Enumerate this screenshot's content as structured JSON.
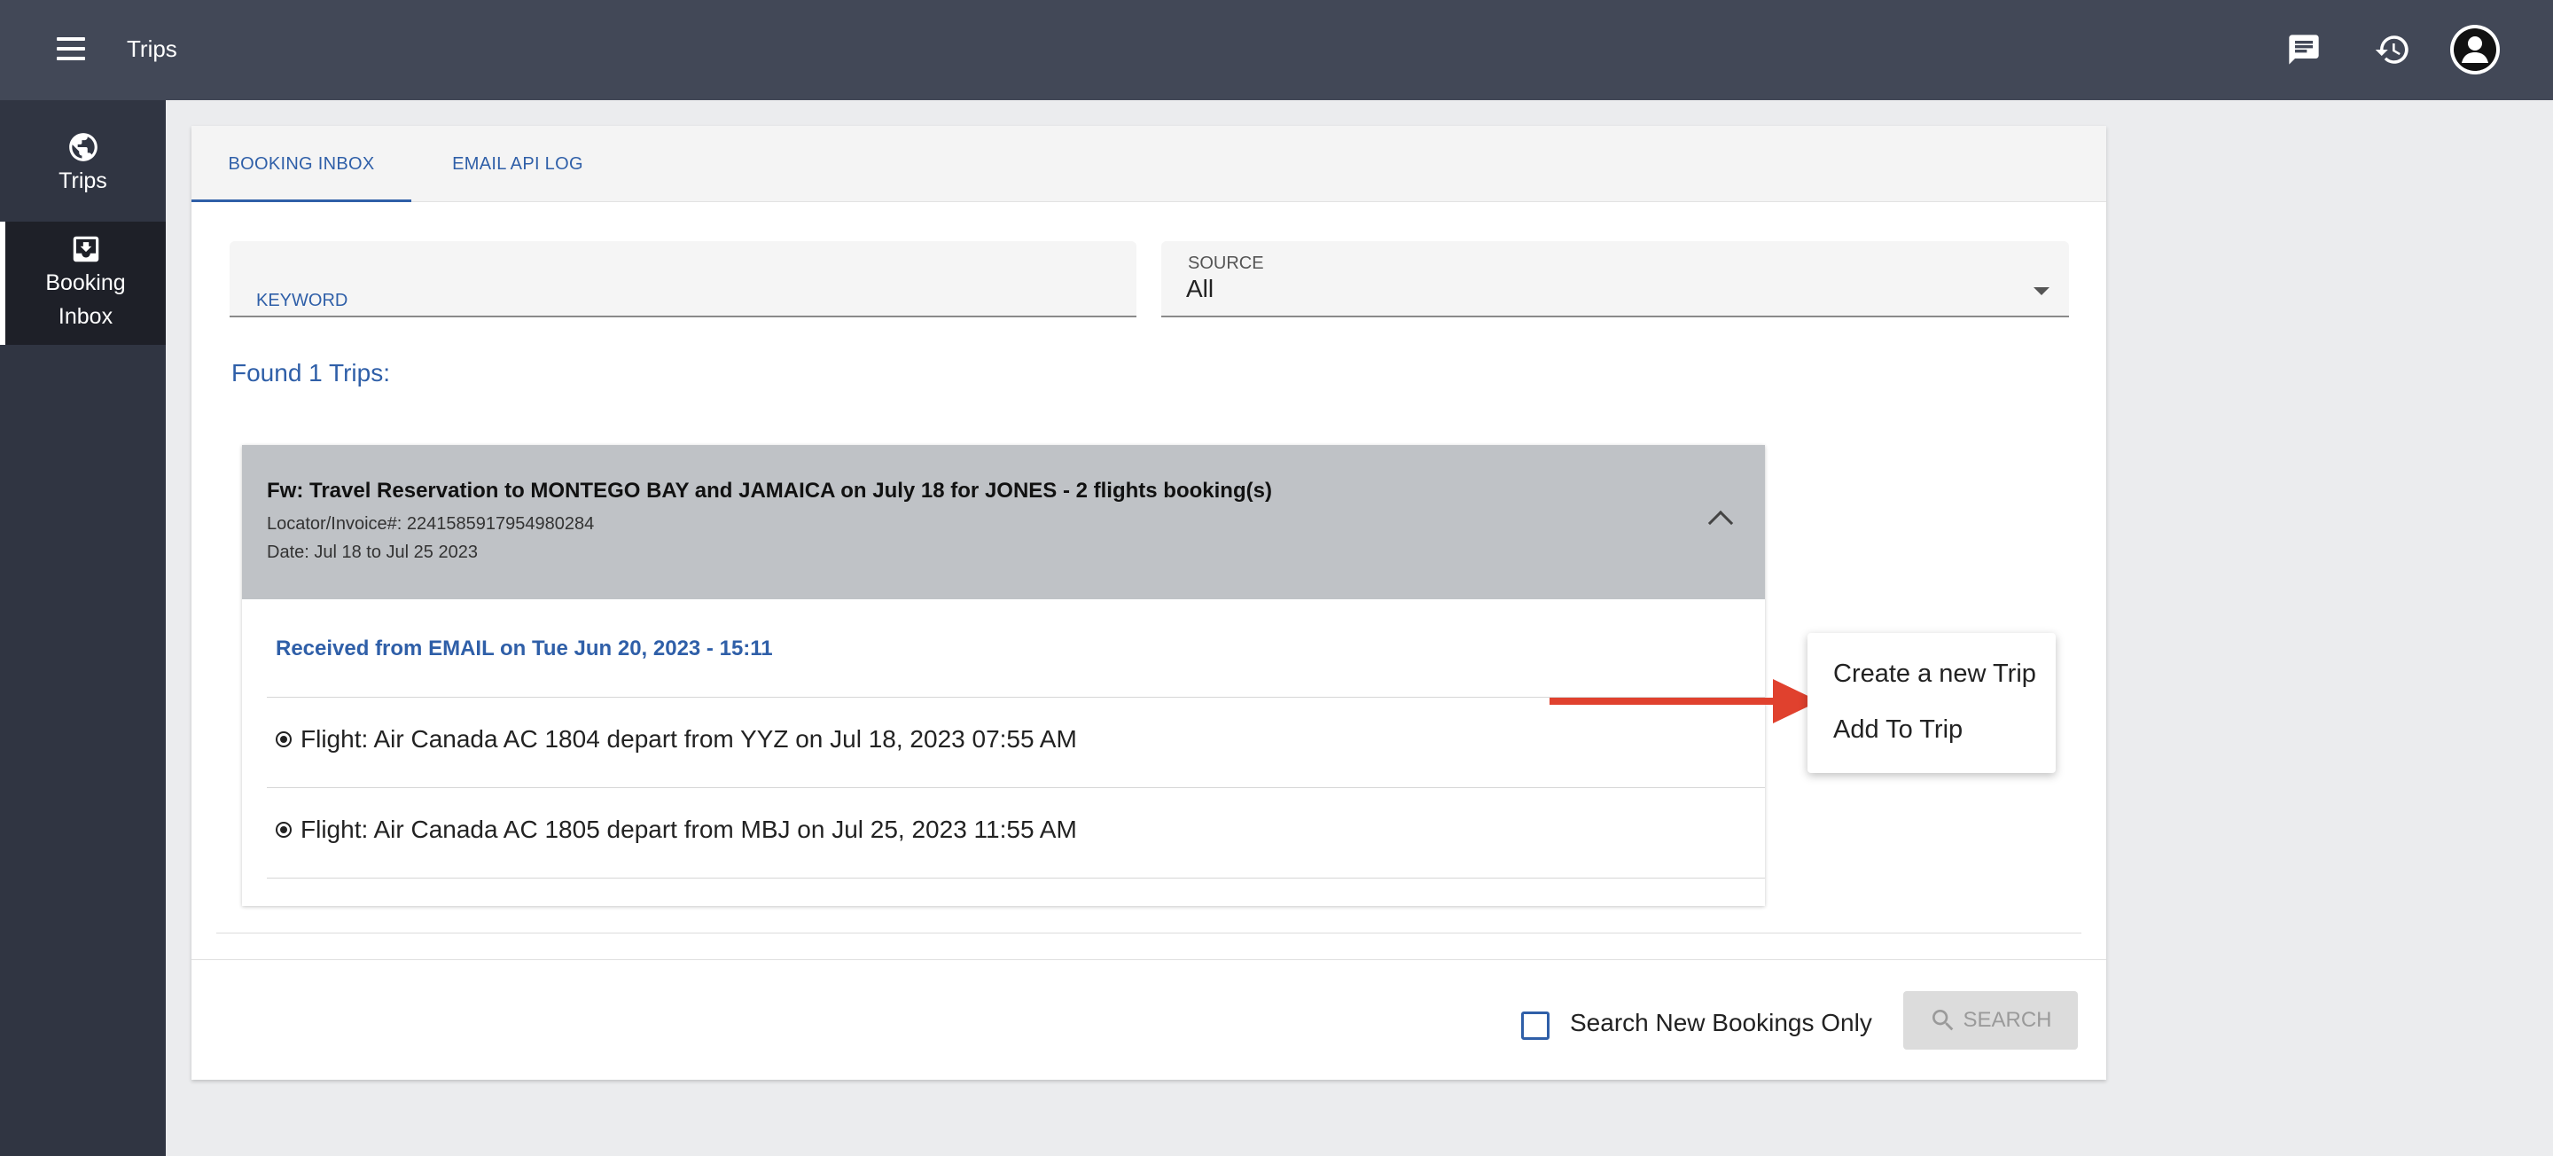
{
  "appbar": {
    "title": "Trips",
    "icons": [
      "menu-icon",
      "chat-icon",
      "history-icon",
      "account-icon"
    ]
  },
  "sidebar": {
    "items": [
      {
        "label": "Trips",
        "icon": "globe-icon"
      },
      {
        "label_line1": "Booking",
        "label_line2": "Inbox",
        "icon": "inbox-download-icon"
      }
    ]
  },
  "tabs": [
    {
      "label": "BOOKING INBOX"
    },
    {
      "label": "EMAIL API LOG"
    }
  ],
  "filters": {
    "keyword_label": "KEYWORD",
    "keyword_value": "",
    "source_label": "SOURCE",
    "source_value": "All"
  },
  "results": {
    "found_text": "Found 1 Trips:"
  },
  "trip": {
    "title": "Fw: Travel Reservation to MONTEGO BAY and JAMAICA on July 18 for JONES - 2 flights booking(s)",
    "locator": "Locator/Invoice#: 2241585917954980284",
    "date": "Date: Jul 18 to Jul 25 2023",
    "received": "Received from EMAIL on Tue Jun 20, 2023 - 15:11",
    "flights": [
      "Flight: Air Canada AC 1804 depart from YYZ on Jul 18, 2023 07:55 AM",
      "Flight: Air Canada AC 1805 depart from MBJ on Jul 25, 2023 11:55 AM"
    ]
  },
  "context_menu": {
    "items": [
      "Create a new Trip",
      "Add To Trip"
    ]
  },
  "footer": {
    "checkbox_label": "Search New Bookings Only",
    "checkbox_checked": false,
    "search_label": "SEARCH"
  },
  "colors": {
    "appbar": "#424857",
    "sidebar": "#303542",
    "accent": "#2f5fa8",
    "annotation_arrow": "#e0412e"
  }
}
